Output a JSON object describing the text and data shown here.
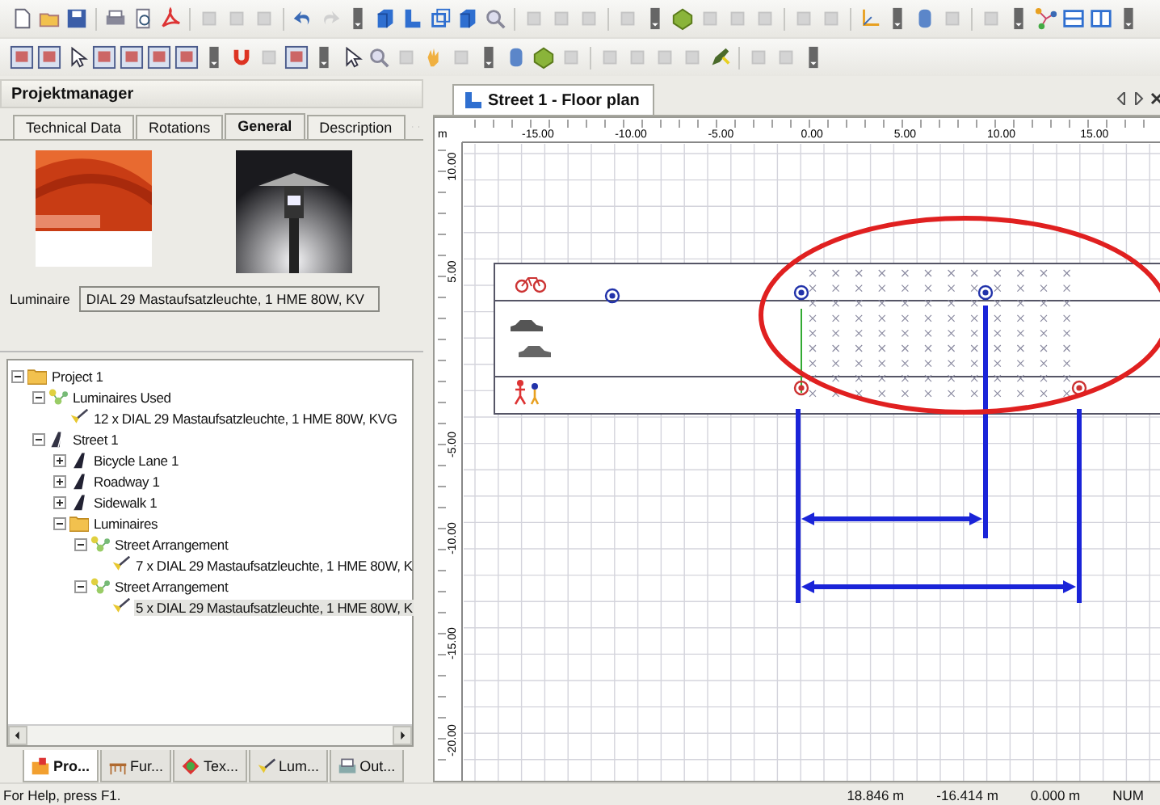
{
  "project_manager": {
    "title": "Projektmanager",
    "tabs": [
      {
        "label": "Technical Data",
        "selected": false
      },
      {
        "label": "Rotations",
        "selected": false
      },
      {
        "label": "General",
        "selected": true
      },
      {
        "label": "Description",
        "selected": false
      }
    ],
    "luminaire_label": "Luminaire",
    "luminaire_value": "DIAL 29 Mastaufsatzleuchte, 1 HME 80W, KV"
  },
  "tree": [
    {
      "kind": "folder",
      "label": "Project 1",
      "expanded": true,
      "selected": false,
      "children": [
        {
          "kind": "arrangement",
          "label": "Luminaires Used",
          "expanded": true,
          "selected": false,
          "children": [
            {
              "kind": "luminaire",
              "label": "12 x DIAL 29 Mastaufsatzleuchte, 1 HME 80W, KVG",
              "selected": false
            }
          ]
        },
        {
          "kind": "street",
          "label": "Street 1",
          "expanded": true,
          "selected": false,
          "children": [
            {
              "kind": "lane",
              "label": "Bicycle Lane 1",
              "expanded": false,
              "selected": false
            },
            {
              "kind": "lane",
              "label": "Roadway 1",
              "expanded": false,
              "selected": false
            },
            {
              "kind": "lane",
              "label": "Sidewalk 1",
              "expanded": false,
              "selected": false
            },
            {
              "kind": "folder",
              "label": "Luminaires",
              "expanded": true,
              "selected": false,
              "children": [
                {
                  "kind": "arrangement",
                  "label": "Street Arrangement",
                  "expanded": true,
                  "selected": false,
                  "children": [
                    {
                      "kind": "luminaire",
                      "label": "7 x DIAL 29 Mastaufsatzleuchte, 1 HME 80W, K",
                      "selected": false
                    }
                  ]
                },
                {
                  "kind": "arrangement",
                  "label": "Street Arrangement",
                  "expanded": true,
                  "selected": false,
                  "children": [
                    {
                      "kind": "luminaire",
                      "label": "5 x DIAL 29 Mastaufsatzleuchte, 1 HME 80W, K",
                      "selected": true
                    }
                  ]
                }
              ]
            }
          ]
        }
      ]
    }
  ],
  "bottom_tabs": [
    {
      "kind": "project",
      "label": "Pro...",
      "selected": true
    },
    {
      "kind": "furniture",
      "label": "Fur...",
      "selected": false
    },
    {
      "kind": "texture",
      "label": "Tex...",
      "selected": false
    },
    {
      "kind": "luminaire",
      "label": "Lum...",
      "selected": false
    },
    {
      "kind": "output",
      "label": "Out...",
      "selected": false
    }
  ],
  "document": {
    "tab": "Street 1 - Floor plan",
    "ruler": {
      "unit": "m",
      "x_labels": [
        "-15.00",
        "-10.00",
        "-5.00",
        "0.00",
        "5.00",
        "10.00",
        "15.00"
      ],
      "y_labels": [
        "10.00",
        "5.00",
        "-5.00",
        "-10.00",
        "-15.00",
        "-20.00"
      ]
    }
  },
  "status_bar": {
    "help": "For Help, press F1.",
    "x": "18.846 m",
    "y": "-16.414 m",
    "z": "0.000 m",
    "mode": "NUM"
  }
}
